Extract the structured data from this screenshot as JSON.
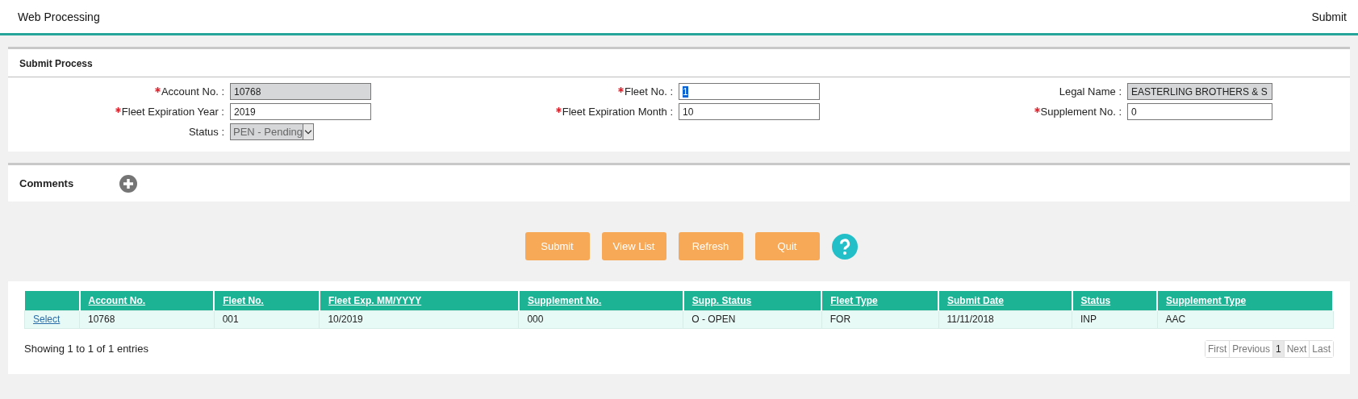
{
  "header": {
    "title": "Web Processing",
    "page": "Submit"
  },
  "submit_process": {
    "title": "Submit Process",
    "fields": [
      {
        "label": "Account No. :",
        "required": true,
        "kind": "text",
        "value": "10768",
        "disabled": true,
        "highlighted": false
      },
      {
        "label": "Fleet No. :",
        "required": true,
        "kind": "text",
        "value": "1",
        "disabled": false,
        "highlighted": true
      },
      {
        "label": "Legal Name :",
        "required": false,
        "kind": "text",
        "value": "EASTERLING BROTHERS & S",
        "disabled": true,
        "highlighted": false
      },
      {
        "label": "Fleet Expiration Year :",
        "required": true,
        "kind": "text",
        "value": "2019",
        "disabled": false,
        "highlighted": false
      },
      {
        "label": "Fleet Expiration Month :",
        "required": true,
        "kind": "text",
        "value": "10",
        "disabled": false,
        "highlighted": false
      },
      {
        "label": "Supplement No. :",
        "required": true,
        "kind": "text",
        "value": "0",
        "disabled": false,
        "highlighted": false
      },
      {
        "label": "Status :",
        "required": false,
        "kind": "select",
        "value": "PEN - Pending",
        "disabled": true,
        "highlighted": false
      }
    ]
  },
  "comments": {
    "title": "Comments"
  },
  "buttons": [
    "Submit",
    "View List",
    "Refresh",
    "Quit"
  ],
  "table": {
    "columns": [
      "",
      "Account No.",
      "Fleet No.",
      "Fleet Exp. MM/YYYY",
      "Supplement No.",
      "Supp. Status",
      "Fleet Type",
      "Submit Date",
      "Status",
      "Supplement Type"
    ],
    "rows": [
      [
        "Select",
        "10768",
        "001",
        "10/2019",
        "000",
        "O - OPEN",
        "FOR",
        "11/11/2018",
        "INP",
        "AAC"
      ]
    ]
  },
  "info": "Showing 1 to 1 of 1 entries",
  "pagination": [
    {
      "label": "First",
      "selected": false
    },
    {
      "label": "Previous",
      "selected": false
    },
    {
      "label": "1",
      "selected": true
    },
    {
      "label": "Next",
      "selected": false
    },
    {
      "label": "Last",
      "selected": false
    }
  ]
}
